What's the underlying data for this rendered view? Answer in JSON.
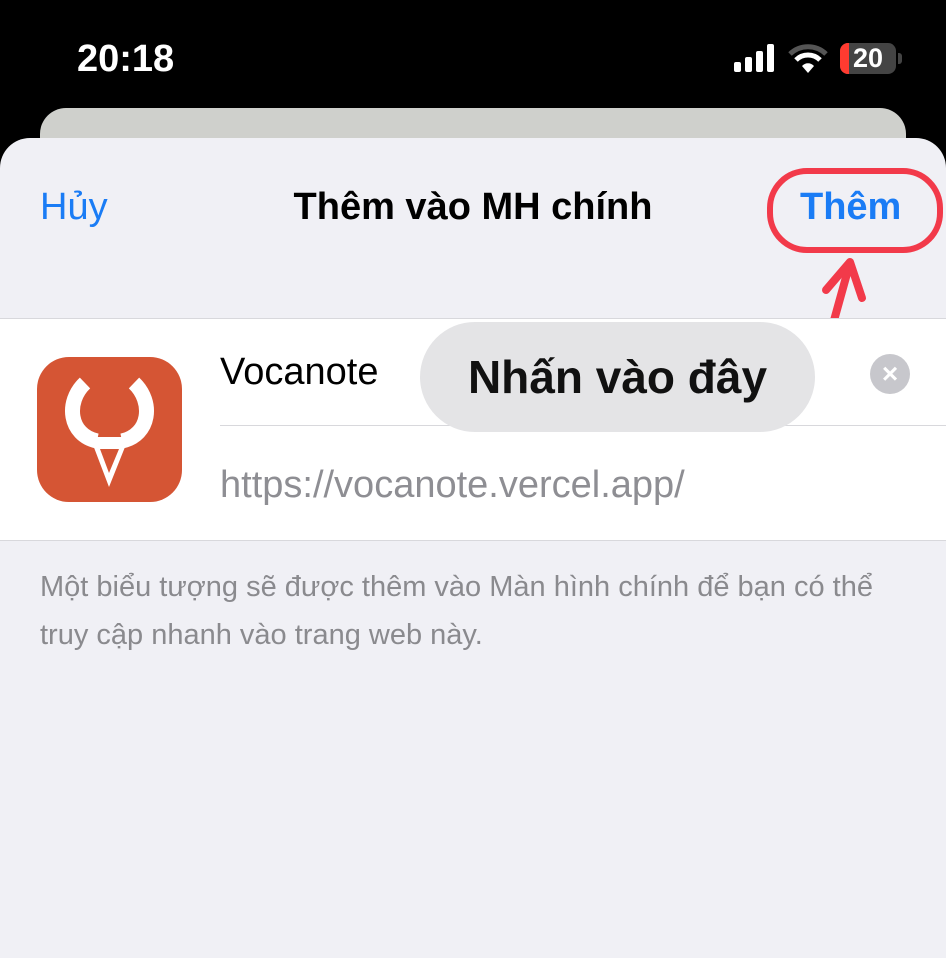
{
  "status_bar": {
    "time": "20:18",
    "battery": "20"
  },
  "header": {
    "cancel": "Hủy",
    "title": "Thêm vào MH chính",
    "add": "Thêm"
  },
  "app": {
    "name": "Vocanote",
    "url": "https://vocanote.vercel.app/"
  },
  "annotation": {
    "tooltip": "Nhấn vào đây",
    "color": "#f23a4a"
  },
  "footer": {
    "text": "Một biểu tượng sẽ được thêm vào Màn hình chính để bạn có thể truy cập nhanh vào trang web này."
  },
  "colors": {
    "accent": "#1a7cf5",
    "icon": "#d55534"
  }
}
